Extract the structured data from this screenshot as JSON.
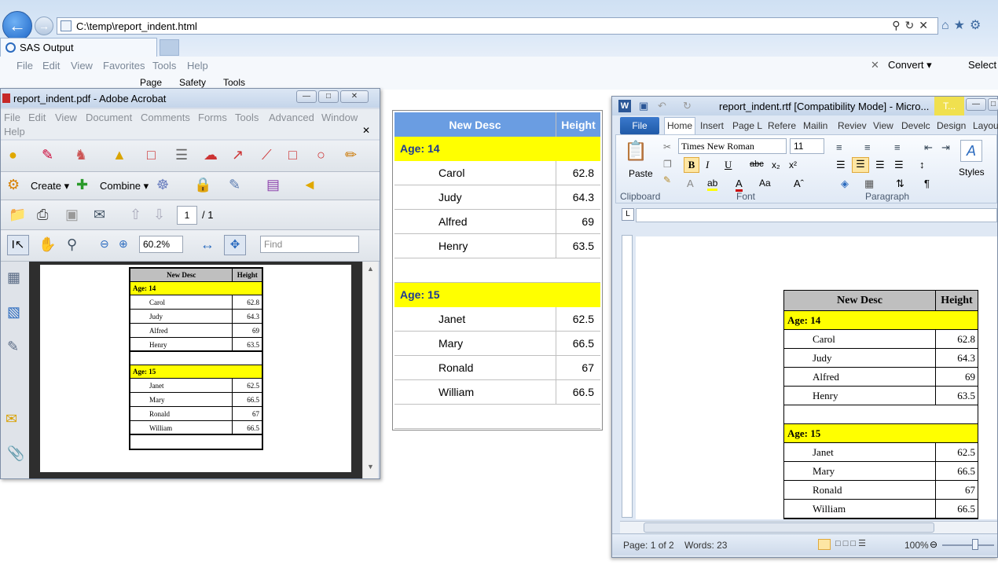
{
  "ie": {
    "address": "C:\\temp\\report_indent.html",
    "tab_title": "SAS Output",
    "menu": [
      "File",
      "Edit",
      "View",
      "Favorites",
      "Tools",
      "Help"
    ],
    "cmd": [
      "Page",
      "Safety",
      "Tools"
    ],
    "convert": "Convert",
    "select": "Select"
  },
  "acrobat": {
    "title": "report_indent.pdf - Adobe Acrobat",
    "menu": [
      "File",
      "Edit",
      "View",
      "Document",
      "Comments",
      "Forms",
      "Tools",
      "Advanced",
      "Window",
      "Help"
    ],
    "create": "Create",
    "combine": "Combine",
    "page_current": "1",
    "page_total": "/ 1",
    "zoom": "60.2%",
    "find_placeholder": "Find"
  },
  "word": {
    "title": "report_indent.rtf [Compatibility Mode] - Micro...",
    "file_tab": "File",
    "tabs": [
      "Home",
      "Insert",
      "Page L",
      "Refere",
      "Mailin",
      "Reviev",
      "View",
      "Develc",
      "Design",
      "Layou"
    ],
    "contextual_tab": "T...",
    "font": "Times New Roman",
    "font_size": "11",
    "paste": "Paste",
    "styles": "Styles",
    "groups": [
      "Clipboard",
      "Font",
      "Paragraph"
    ],
    "status_page": "Page: 1 of 2",
    "status_words": "Words: 23",
    "zoom": "100%"
  },
  "report": {
    "col1": "New Desc",
    "col2": "Height",
    "groups": [
      {
        "label": "Age: 14",
        "rows": [
          {
            "name": "Carol",
            "height": "62.8"
          },
          {
            "name": "Judy",
            "height": "64.3"
          },
          {
            "name": "Alfred",
            "height": "69"
          },
          {
            "name": "Henry",
            "height": "63.5"
          }
        ]
      },
      {
        "label": "Age: 15",
        "rows": [
          {
            "name": "Janet",
            "height": "62.5"
          },
          {
            "name": "Mary",
            "height": "66.5"
          },
          {
            "name": "Ronald",
            "height": "67"
          },
          {
            "name": "William",
            "height": "66.5"
          }
        ]
      }
    ]
  }
}
